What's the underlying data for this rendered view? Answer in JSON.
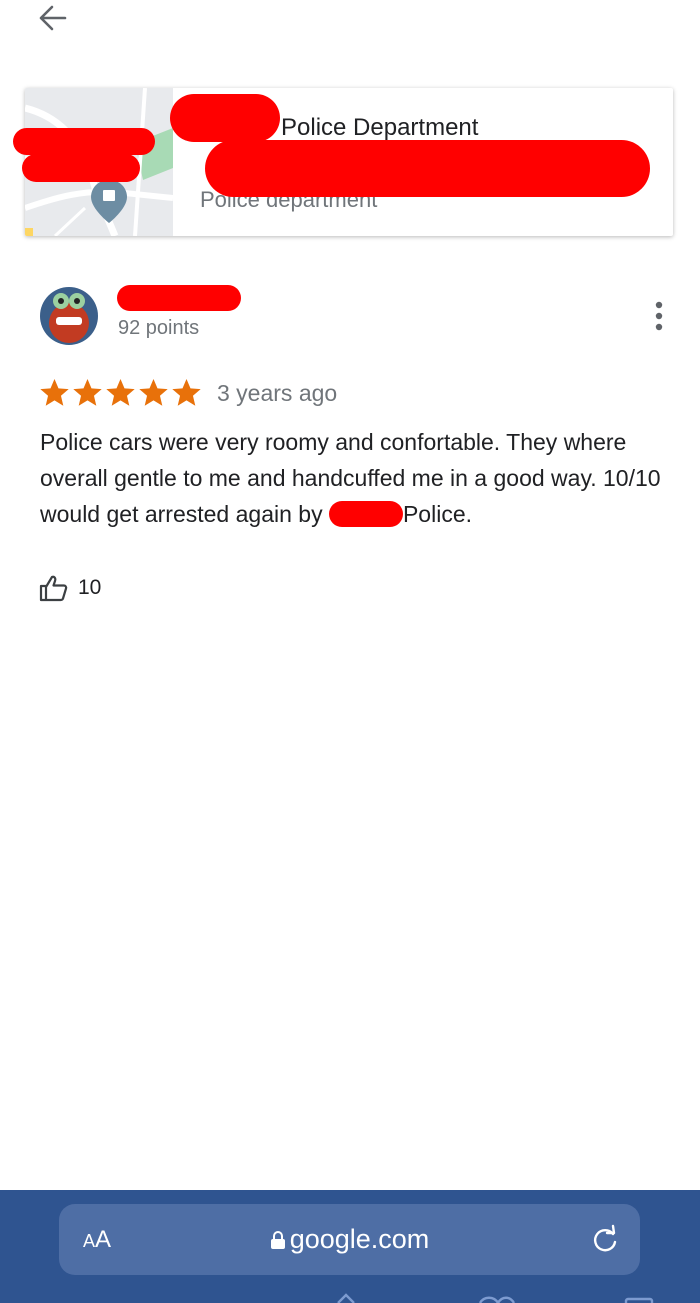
{
  "header": {
    "back_icon": "arrow-left-icon"
  },
  "place": {
    "name": "Police Department",
    "category": "Police department",
    "map_icon": "police-pin-icon"
  },
  "review": {
    "points": "92 points",
    "rating": 5,
    "time": "3 years ago",
    "text_before": "Police cars were very roomy and confortable. They where overall gentle to me and handcuffed me in a good way. 10/10 would get arrested again by ",
    "text_after": "Police.",
    "likes": "10",
    "more_icon": "more-vert-icon",
    "like_icon": "thumb-up-icon"
  },
  "browser": {
    "aa_small": "A",
    "aa_large": "A",
    "url": "google.com",
    "lock_icon": "lock-icon",
    "reload_icon": "reload-icon"
  },
  "colors": {
    "star": "#e8710a",
    "redaction": "#ff0000",
    "browser_bar": "#2f5490",
    "url_field": "#4e6ea5",
    "secondary_text": "#70757a"
  }
}
